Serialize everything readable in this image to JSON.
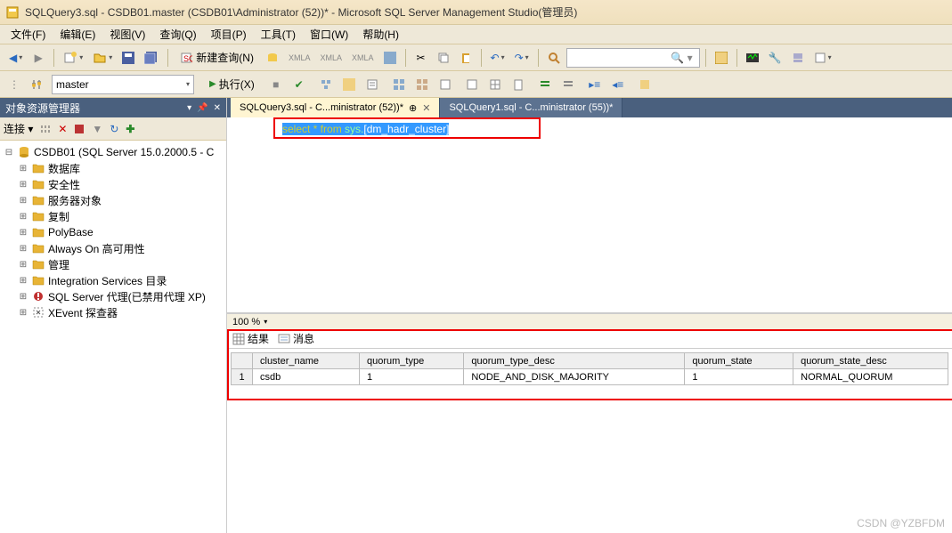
{
  "title": "SQLQuery3.sql - CSDB01.master (CSDB01\\Administrator (52))* - Microsoft SQL Server Management Studio(管理员)",
  "menu": [
    "文件(F)",
    "编辑(E)",
    "视图(V)",
    "查询(Q)",
    "项目(P)",
    "工具(T)",
    "窗口(W)",
    "帮助(H)"
  ],
  "toolbar": {
    "newquery": "新建查询(N)",
    "execute": "执行(X)"
  },
  "db_selected": "master",
  "sidebar": {
    "title": "对象资源管理器",
    "connect": "连接 ▾",
    "server": "CSDB01 (SQL Server 15.0.2000.5 - C",
    "nodes": [
      "数据库",
      "安全性",
      "服务器对象",
      "复制",
      "PolyBase",
      "Always On 高可用性",
      "管理",
      "Integration Services 目录",
      "SQL Server 代理(已禁用代理 XP)",
      "XEvent 探查器"
    ]
  },
  "tabs": [
    {
      "label": "SQLQuery3.sql - C...ministrator (52))*",
      "active": true,
      "pin": "⊕"
    },
    {
      "label": "SQLQuery1.sql - C...ministrator (55))*",
      "active": false
    }
  ],
  "sql": {
    "pre": "select * from ",
    "sys": "sys.",
    "obj": "[dm_hadr_cluster]"
  },
  "zoom": "100 %",
  "result_tabs": {
    "results": "结果",
    "messages": "消息"
  },
  "grid": {
    "headers": [
      "",
      "cluster_name",
      "quorum_type",
      "quorum_type_desc",
      "quorum_state",
      "quorum_state_desc"
    ],
    "rows": [
      [
        "1",
        "csdb",
        "1",
        "NODE_AND_DISK_MAJORITY",
        "1",
        "NORMAL_QUORUM"
      ]
    ]
  },
  "watermark": "CSDN @YZBFDM"
}
